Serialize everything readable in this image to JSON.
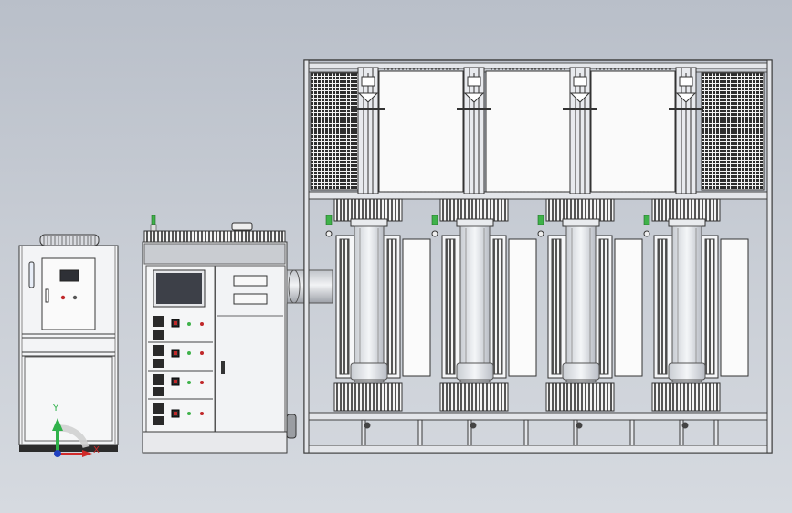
{
  "scene": {
    "background_top": "#b9bfc9",
    "background_bottom": "#d6dae0",
    "line_color": "#3a3a3a",
    "panel_white": "#f4f5f7",
    "frame_color": "#e4e6ea",
    "screen_color": "#3d4048",
    "indicator_green": "#3fb24a",
    "indicator_red": "#c0282a",
    "button_dark": "#2a2a2a"
  },
  "chiller": {
    "name": "water-chiller"
  },
  "control_cabinet": {
    "name": "control-cabinet",
    "control_rows": 4
  },
  "furnace_frame": {
    "name": "tube-furnace-frame",
    "station_count": 4
  },
  "axis_triad": {
    "y_label": "Y",
    "x_label": "X",
    "y_color": "#2fb24a",
    "x_color": "#d02a2a",
    "origin_color": "#2040c0"
  }
}
